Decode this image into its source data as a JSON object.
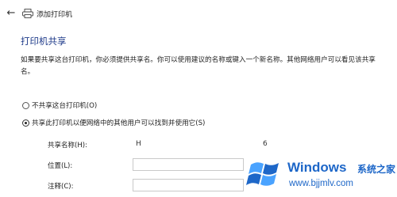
{
  "window": {
    "back_icon": "←",
    "title": "添加打印机"
  },
  "page": {
    "heading": "打印机共享",
    "description": "如果要共享这台打印机，你必须提供共享名。你可以使用建议的名称或键入一个新名称。其他网络用户可以看见该共享名。"
  },
  "options": [
    {
      "label": "不共享这台打印机(O)",
      "checked": false
    },
    {
      "label": "共享此打印机以便网络中的其他用户可以找到并使用它(S)",
      "checked": true
    }
  ],
  "fields": {
    "share_name": {
      "label": "共享名称(H):",
      "value_start": "H",
      "value_end": "6"
    },
    "location": {
      "label": "位置(L):",
      "value": ""
    },
    "comment": {
      "label": "注释(C):",
      "value": ""
    }
  },
  "watermark": {
    "brand": "Windows",
    "brand_cn": "系统之家",
    "url": "www.bjjmlv.com",
    "color": "#1e67c8"
  }
}
